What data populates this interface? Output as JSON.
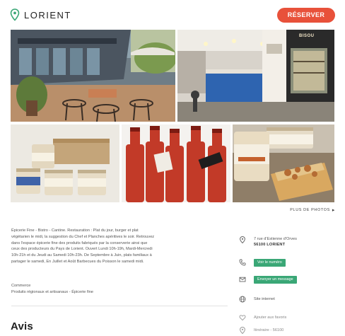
{
  "header": {
    "city": "LORIENT",
    "reserve_label": "RÉSERVER"
  },
  "gallery": {
    "photo_sign": "BISOU"
  },
  "more_photos": "PLUS DE PHOTOS",
  "description": {
    "lines": [
      "Épicerie Fine - Bistro - Cantine. Restauration : Plat du jour, burger et plat",
      "végétarien le midi, la suggestion du Chef et Planches apéritives le soir. Retrouvez",
      "dans l'espace épicerie fine des produits fabriqués par la conserverie ainsi que",
      "ceux des producteurs du Pays de Lorient. Ouvert Lundi 10h-19h, Mardi-Mercredi",
      "10h-21h et du Jeudi au Samedi 10h-23h. De Septembre à Juin, plats familiaux à",
      "partager le samedi, En Juillet et Août Barbecues du Poisson le samedi midi."
    ],
    "category_title": "Commerce",
    "category_value": "Produits régionaux et artisanaux - Épicerie fine"
  },
  "info": {
    "address_line1": "7 rue d'Estienne d'Orves",
    "address_line2": "56100 LORIENT",
    "phone_button": "Voir le numéro",
    "email_button": "Envoyer un message",
    "website": "Site internet",
    "favorite": "Ajouter aux favoris",
    "itinerary": "Itinéraire - 56100"
  },
  "reviews_title": "Avis",
  "colors": {
    "accent": "#e8513a",
    "green": "#3aa776"
  }
}
